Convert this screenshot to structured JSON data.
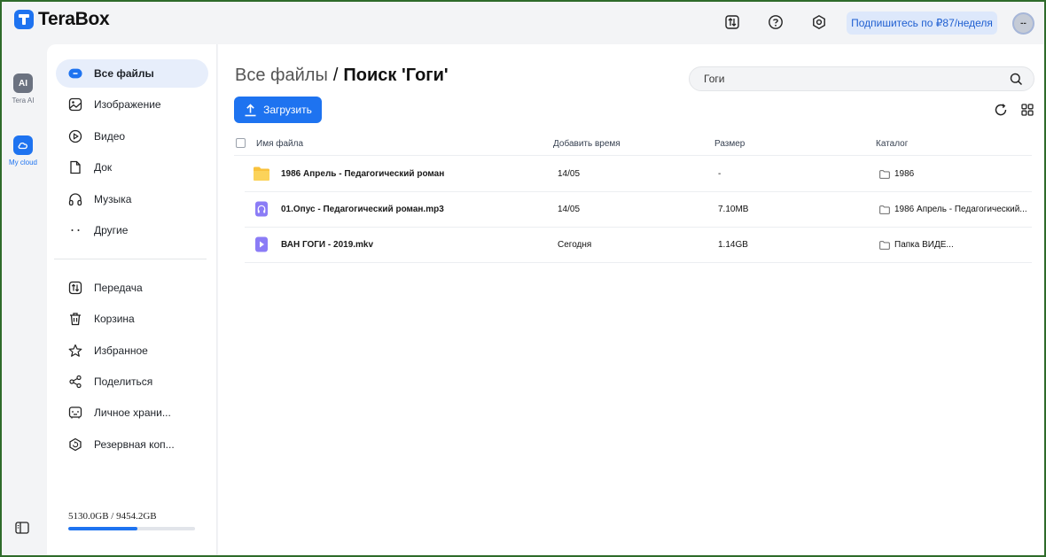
{
  "app": {
    "name": "TeraBox"
  },
  "topbar": {
    "subscribe_label": "Подпишитесь по ₽87/неделя",
    "avatar_label": "--"
  },
  "rail": {
    "items": [
      {
        "label": "Tera AI",
        "icon": "AI"
      },
      {
        "label": "My cloud"
      }
    ]
  },
  "sidebar": {
    "primary": [
      {
        "label": "Все файлы",
        "icon": "all-files-icon"
      },
      {
        "label": "Изображение",
        "icon": "image-icon"
      },
      {
        "label": "Видео",
        "icon": "video-icon"
      },
      {
        "label": "Док",
        "icon": "document-icon"
      },
      {
        "label": "Музыка",
        "icon": "headphones-icon"
      },
      {
        "label": "Другие",
        "icon": "more-icon"
      }
    ],
    "secondary": [
      {
        "label": "Передача",
        "icon": "transfer-icon"
      },
      {
        "label": "Корзина",
        "icon": "trash-icon"
      },
      {
        "label": "Избранное",
        "icon": "star-icon"
      },
      {
        "label": "Поделиться",
        "icon": "share-icon"
      },
      {
        "label": "Личное храни...",
        "icon": "safe-icon"
      },
      {
        "label": "Резервная коп...",
        "icon": "backup-icon"
      }
    ],
    "storage": {
      "text": "5130.0GB / 9454.2GB",
      "used_fraction": 0.543
    }
  },
  "main": {
    "breadcrumb_root": "Все файлы",
    "breadcrumb_sep": "/",
    "breadcrumb_current": "Поиск 'Гоги'",
    "search_value": "Гоги",
    "upload_label": "Загрузить",
    "columns": {
      "name": "Имя файла",
      "added": "Добавить время",
      "size": "Размер",
      "catalog": "Каталог"
    },
    "rows": [
      {
        "name": "1986 Апрель - Педагогический роман",
        "type": "folder",
        "added": "14/05",
        "size": "-",
        "catalog": "1986"
      },
      {
        "name": "01.Опус - Педагогический роман.mp3",
        "type": "audio",
        "added": "14/05",
        "size": "7.10MB",
        "catalog": "1986 Апрель - Педагогический..."
      },
      {
        "name": "ВАН ГОГИ - 2019.mkv",
        "type": "video",
        "added": "Сегодня",
        "size": "1.14GB",
        "catalog": "Папка ВИДЕ..."
      }
    ]
  },
  "colors": {
    "accent": "#1e73f0",
    "active_nav_bg": "#e7eefb",
    "subscribe_bg": "#dde8fb",
    "folder": "#f9c23c",
    "media_file": "#8b7cf6"
  }
}
